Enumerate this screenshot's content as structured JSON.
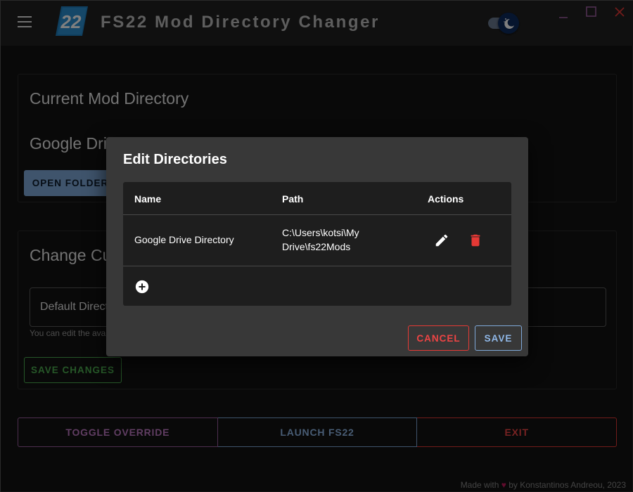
{
  "app": {
    "title": "FS22 Mod Directory Changer",
    "logo_text": "22"
  },
  "current_card": {
    "title": "Current Mod Directory",
    "directory_name": "Google Drive Directory",
    "open_folder_label": "OPEN FOLDER"
  },
  "change_card": {
    "title": "Change Current Mod Directory",
    "select_value": "Default Directory",
    "helper_text": "You can edit the available directories from the menu",
    "save_changes_label": "SAVE CHANGES"
  },
  "bottom_bar": {
    "toggle_label": "TOGGLE OVERRIDE",
    "launch_label": "LAUNCH FS22",
    "exit_label": "EXIT"
  },
  "footer": {
    "made_with": "Made with",
    "by": "by Konstantinos Andreou, 2023"
  },
  "dialog": {
    "title": "Edit Directories",
    "columns": [
      "Name",
      "Path",
      "Actions"
    ],
    "rows": [
      {
        "name": "Google Drive Directory",
        "path_line1": "C:\\Users\\kotsi\\My",
        "path_line2": "Drive\\fs22Mods"
      }
    ],
    "cancel_label": "CANCEL",
    "save_label": "SAVE"
  },
  "colors": {
    "accent_purple": "#9c5fa0",
    "accent_blue": "#7fa8d8",
    "accent_red": "#e53935",
    "accent_green": "#4caf50",
    "logo_blue": "#1e7fbf"
  },
  "icons": {
    "menu": "menu-icon",
    "theme": "moon-icon",
    "minimize": "minimize-icon",
    "maximize": "maximize-icon",
    "close": "close-icon",
    "edit": "pencil-icon",
    "delete": "trash-icon",
    "add": "add-circle-icon"
  }
}
